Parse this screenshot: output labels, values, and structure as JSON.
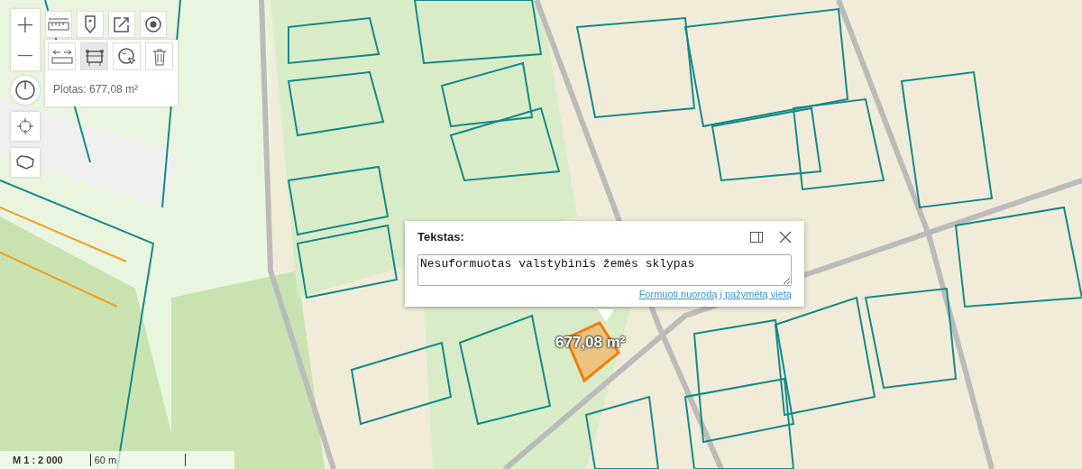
{
  "map_controls": {
    "zoom_in": {
      "label": "+"
    },
    "zoom_out": {
      "label": "−"
    }
  },
  "measure_tools": {
    "row_1": [
      {
        "kind": "ruler",
        "selected": false
      },
      {
        "kind": "pin",
        "selected": false
      },
      {
        "kind": "share",
        "selected": false
      },
      {
        "kind": "target",
        "selected": false
      }
    ],
    "row_2": [
      {
        "kind": "distance",
        "selected": false
      },
      {
        "kind": "area",
        "selected": true
      },
      {
        "kind": "globe",
        "selected": false
      },
      {
        "kind": "trash",
        "selected": false
      }
    ],
    "result": "Plotas: 677,08 m²"
  },
  "side_tools": [
    {
      "kind": "power"
    },
    {
      "kind": "locate"
    },
    {
      "kind": "outline"
    }
  ],
  "popup": {
    "title": "Tekstas:",
    "text": "Nesuformuotas valstybinis žemės sklypas",
    "link": "Formuoti nuorodą į pažymėtą vietą"
  },
  "area_label": "677,08 m²",
  "scale": {
    "ratio": "M 1 : 2 000",
    "bar": "60 m"
  }
}
